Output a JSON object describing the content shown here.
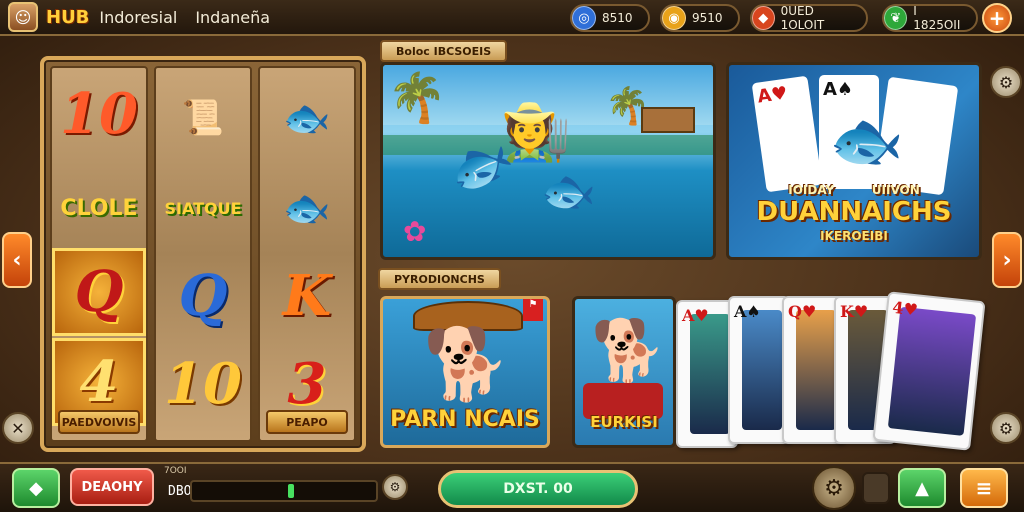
{
  "header": {
    "logo": "HUB",
    "title_left": "Indoresial",
    "title_right": "Indaneña",
    "chips": [
      {
        "icon": "globe-icon",
        "value": "8510",
        "color": "#2f6fd8"
      },
      {
        "icon": "coin-icon",
        "value": "9510",
        "color": "#e8a21a"
      },
      {
        "icon": "gem-icon",
        "value": "0UED 1OLOIT",
        "color": "#d8451e"
      },
      {
        "icon": "leaf-icon",
        "value": "I 1825OII",
        "color": "#2ea83a"
      }
    ],
    "plus": "+"
  },
  "reels": {
    "col1": [
      "10",
      "CLOLE",
      "Q",
      "4"
    ],
    "col1_label": "PAEDVOIVIS",
    "col2": [
      "SIATQUE",
      "Q",
      "10"
    ],
    "col3": [
      "K",
      "3"
    ],
    "col3_label": "PEAPO"
  },
  "tiles": {
    "top_tag": "Boloc IBCSOEIS",
    "cards_title": "DUANNAICHS",
    "cards_sub_left": "IOIDAY",
    "cards_sub_right": "UIIVON",
    "cards_caption": "IKEROEIBI",
    "bottom_tag": "PYRODIONCHS",
    "dog1_title": "PARN NCAIS",
    "dog2_title": "EURKISI"
  },
  "cards": [
    {
      "rank": "A",
      "suit": "♥",
      "color": "#d01818"
    },
    {
      "rank": "A",
      "suit": "♠",
      "color": "#111111"
    },
    {
      "rank": "Q",
      "suit": "♥",
      "color": "#d01818"
    },
    {
      "rank": "K",
      "suit": "♥",
      "color": "#d01818"
    },
    {
      "rank": "4",
      "suit": "♥",
      "color": "#d01818"
    }
  ],
  "bottom": {
    "diamond": "◆",
    "deploy_label": "DEAOHY",
    "stat_label": "7OOI",
    "stat_value": "DBO",
    "main_button": "DXST. 00",
    "up_arrow": "▲",
    "menu": "≡"
  },
  "side": {
    "left_arrow": "‹",
    "right_arrow": "›",
    "close": "✕",
    "gear": "⚙"
  }
}
